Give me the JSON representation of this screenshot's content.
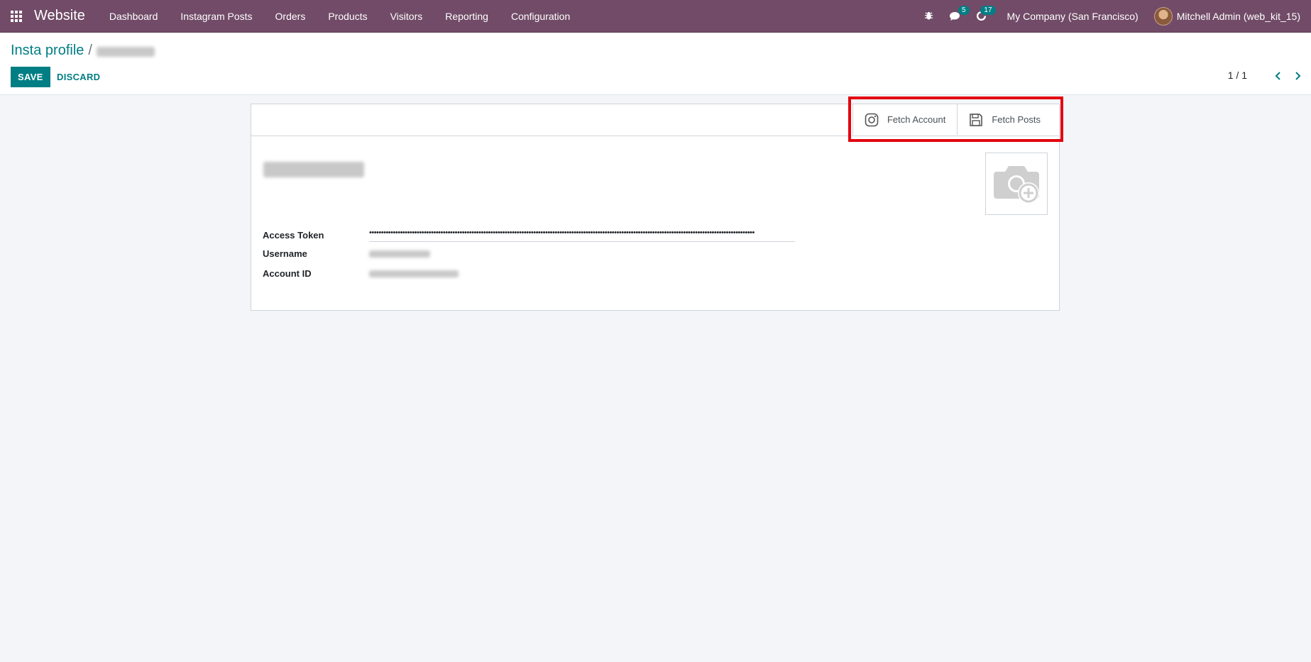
{
  "navbar": {
    "app_name": "Website",
    "menu": [
      "Dashboard",
      "Instagram Posts",
      "Orders",
      "Products",
      "Visitors",
      "Reporting",
      "Configuration"
    ],
    "messages_count": "5",
    "activities_count": "17",
    "company": "My Company (San Francisco)",
    "user": "Mitchell Admin (web_kit_15)"
  },
  "breadcrumb": {
    "parent": "Insta profile",
    "separator": "/"
  },
  "actions": {
    "save_label": "SAVE",
    "discard_label": "DISCARD"
  },
  "pager": {
    "value": "1 / 1"
  },
  "form": {
    "smart_buttons": {
      "fetch_account": "Fetch Account",
      "fetch_posts": "Fetch Posts"
    },
    "fields": {
      "access_token_label": "Access Token",
      "access_token_value": "••••••••••••••••••••••••••••••••••••••••••••••••••••••••••••••••••••••••••••••••••••••••••••••••••••••••••••••••••••••••••••••••••••••••••••••••••••••••••••••••••",
      "username_label": "Username",
      "account_id_label": "Account ID"
    }
  },
  "colors": {
    "navbar": "#714b67",
    "primary": "#017e84",
    "highlight": "#e3050f"
  }
}
